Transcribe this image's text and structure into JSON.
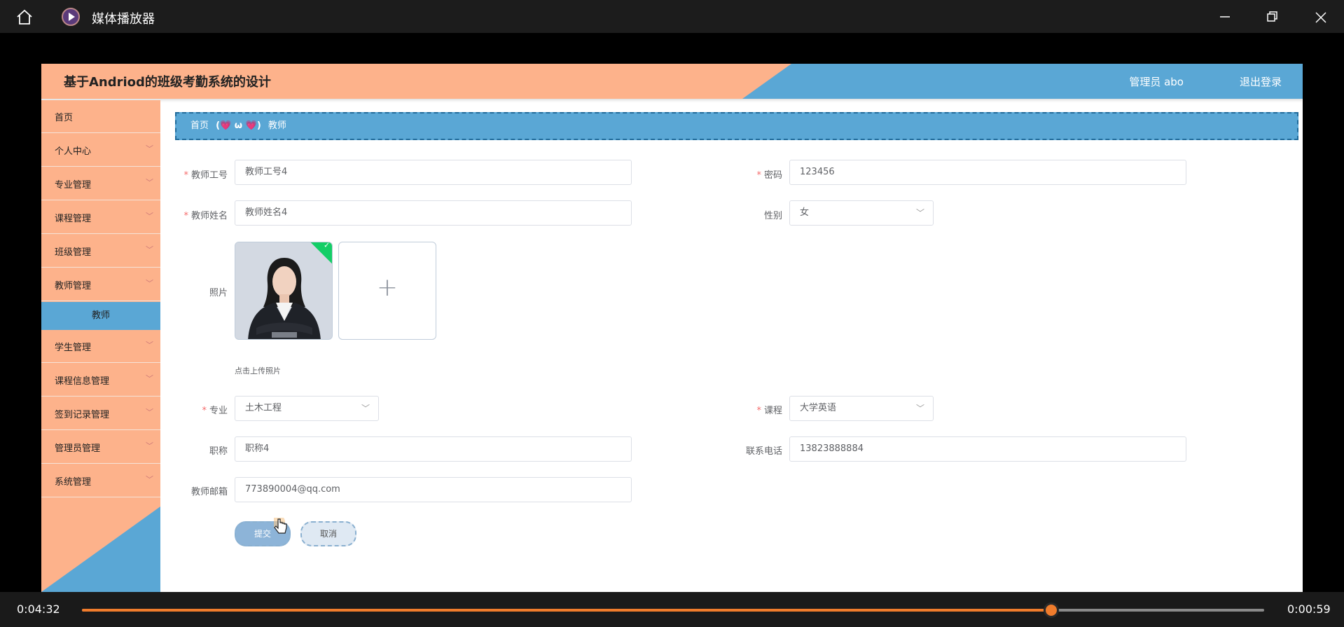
{
  "player": {
    "title": "媒体播放器",
    "time_elapsed": "0:04:32",
    "time_remaining": "0:00:59",
    "progress_fraction": 0.82,
    "accent_color": "#f07c2c"
  },
  "app": {
    "title": "基于Andriod的班级考勤系统的设计",
    "user_label": "管理员 abo",
    "logout_label": "退出登录",
    "header_color": "#fdb28b",
    "accent_blue": "#5aa7d5"
  },
  "sidebar": {
    "items": [
      {
        "label": "首页",
        "has_children": false
      },
      {
        "label": "个人中心",
        "has_children": true
      },
      {
        "label": "专业管理",
        "has_children": true
      },
      {
        "label": "课程管理",
        "has_children": true
      },
      {
        "label": "班级管理",
        "has_children": true
      },
      {
        "label": "教师管理",
        "has_children": true
      },
      {
        "label": "学生管理",
        "has_children": true
      },
      {
        "label": "课程信息管理",
        "has_children": true
      },
      {
        "label": "签到记录管理",
        "has_children": true
      },
      {
        "label": "管理员管理",
        "has_children": true
      },
      {
        "label": "系统管理",
        "has_children": true
      }
    ],
    "active_sub": "教师"
  },
  "breadcrumb": {
    "home": "首页",
    "separator": "(💗 ω 💗)",
    "current": "教师"
  },
  "form": {
    "teacher_id": {
      "label": "教师工号",
      "value": "教师工号4",
      "required": true
    },
    "password": {
      "label": "密码",
      "value": "123456",
      "required": true
    },
    "teacher_name": {
      "label": "教师姓名",
      "value": "教师姓名4",
      "required": true
    },
    "gender": {
      "label": "性别",
      "value": "女"
    },
    "photo": {
      "label": "照片",
      "hint": "点击上传照片"
    },
    "major": {
      "label": "专业",
      "value": "土木工程",
      "required": true
    },
    "course": {
      "label": "课程",
      "value": "大学英语",
      "required": true
    },
    "title": {
      "label": "职称",
      "value": "职称4"
    },
    "phone": {
      "label": "联系电话",
      "value": "13823888884"
    },
    "email": {
      "label": "教师邮箱",
      "value": "773890004@qq.com"
    },
    "submit_label": "提交",
    "cancel_label": "取消"
  }
}
